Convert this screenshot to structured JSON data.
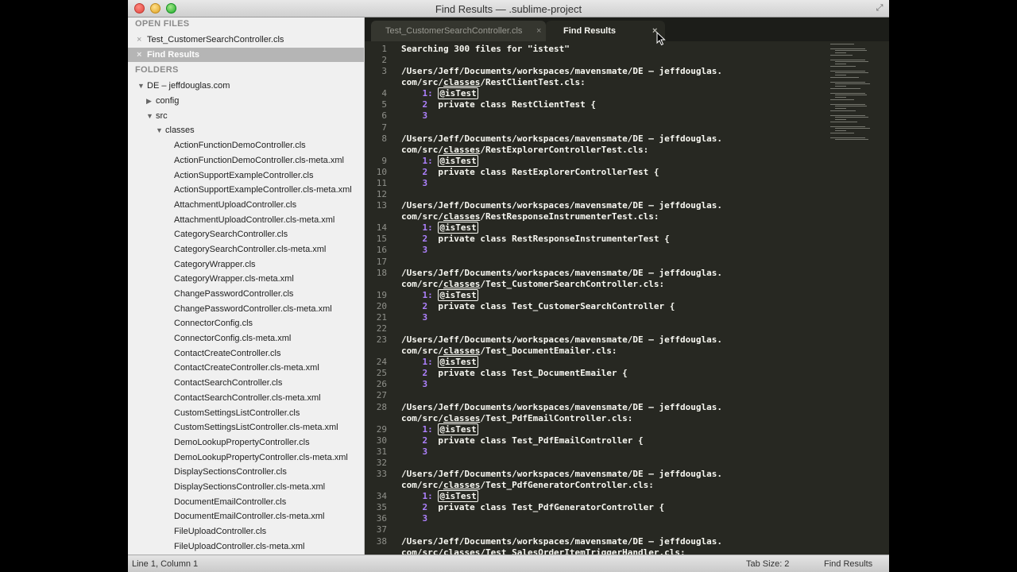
{
  "window": {
    "title": "Find Results — .sublime-project"
  },
  "sidebar": {
    "open_files_header": "OPEN FILES",
    "open_files": [
      {
        "label": "Test_CustomerSearchController.cls",
        "selected": false
      },
      {
        "label": "Find Results",
        "selected": true
      }
    ],
    "folders_header": "FOLDERS",
    "tree": [
      {
        "label": "DE – jeffdouglas.com",
        "indent": 0,
        "arrow": "down"
      },
      {
        "label": "config",
        "indent": 1,
        "arrow": "right"
      },
      {
        "label": "src",
        "indent": 1,
        "arrow": "down"
      },
      {
        "label": "classes",
        "indent": 2,
        "arrow": "down"
      },
      {
        "label": "ActionFunctionDemoController.cls",
        "indent": 3
      },
      {
        "label": "ActionFunctionDemoController.cls-meta.xml",
        "indent": 3
      },
      {
        "label": "ActionSupportExampleController.cls",
        "indent": 3
      },
      {
        "label": "ActionSupportExampleController.cls-meta.xml",
        "indent": 3
      },
      {
        "label": "AttachmentUploadController.cls",
        "indent": 3
      },
      {
        "label": "AttachmentUploadController.cls-meta.xml",
        "indent": 3
      },
      {
        "label": "CategorySearchController.cls",
        "indent": 3
      },
      {
        "label": "CategorySearchController.cls-meta.xml",
        "indent": 3
      },
      {
        "label": "CategoryWrapper.cls",
        "indent": 3
      },
      {
        "label": "CategoryWrapper.cls-meta.xml",
        "indent": 3
      },
      {
        "label": "ChangePasswordController.cls",
        "indent": 3
      },
      {
        "label": "ChangePasswordController.cls-meta.xml",
        "indent": 3
      },
      {
        "label": "ConnectorConfig.cls",
        "indent": 3
      },
      {
        "label": "ConnectorConfig.cls-meta.xml",
        "indent": 3
      },
      {
        "label": "ContactCreateController.cls",
        "indent": 3
      },
      {
        "label": "ContactCreateController.cls-meta.xml",
        "indent": 3
      },
      {
        "label": "ContactSearchController.cls",
        "indent": 3
      },
      {
        "label": "ContactSearchController.cls-meta.xml",
        "indent": 3
      },
      {
        "label": "CustomSettingsListController.cls",
        "indent": 3
      },
      {
        "label": "CustomSettingsListController.cls-meta.xml",
        "indent": 3
      },
      {
        "label": "DemoLookupPropertyController.cls",
        "indent": 3
      },
      {
        "label": "DemoLookupPropertyController.cls-meta.xml",
        "indent": 3
      },
      {
        "label": "DisplaySectionsController.cls",
        "indent": 3
      },
      {
        "label": "DisplaySectionsController.cls-meta.xml",
        "indent": 3
      },
      {
        "label": "DocumentEmailController.cls",
        "indent": 3
      },
      {
        "label": "DocumentEmailController.cls-meta.xml",
        "indent": 3
      },
      {
        "label": "FileUploadController.cls",
        "indent": 3
      },
      {
        "label": "FileUploadController.cls-meta.xml",
        "indent": 3
      }
    ]
  },
  "tabs": [
    {
      "label": "Test_CustomerSearchController.cls",
      "active": false,
      "close": "×"
    },
    {
      "label": "Find Results",
      "active": true,
      "close": "×"
    }
  ],
  "editor": {
    "search_header": "Searching 300 files for \"istest\"",
    "path_prefix": "/Users/Jeff/Documents/workspaces/mavensmate/DE – jeffdouglas.",
    "path_mid_prefix": "com/src/",
    "path_folder": "classes",
    "marker": "1:",
    "annotation": "@isTest",
    "results": [
      {
        "file": "RestClientTest.cls:",
        "class_line": "private class RestClientTest {"
      },
      {
        "file": "RestExplorerControllerTest.cls:",
        "class_line": "private class RestExplorerControllerTest {"
      },
      {
        "file": "RestResponseInstrumenterTest.cls:",
        "class_line": "private class RestResponseInstrumenterTest {"
      },
      {
        "file": "Test_CustomerSearchController.cls:",
        "class_line": "private class Test_CustomerSearchController {"
      },
      {
        "file": "Test_DocumentEmailer.cls:",
        "class_line": "private class Test_DocumentEmailer {"
      },
      {
        "file": "Test_PdfEmailController.cls:",
        "class_line": "private class Test_PdfEmailController {"
      },
      {
        "file": "Test_PdfGeneratorController.cls:",
        "class_line": "private class Test_PdfGeneratorController {"
      },
      {
        "file": "Test_SalesOrderItemTriggerHandler.cls:",
        "class_line": ""
      }
    ]
  },
  "status": {
    "position": "Line 1, Column 1",
    "tab_size": "Tab Size: 2",
    "syntax": "Find Results"
  }
}
